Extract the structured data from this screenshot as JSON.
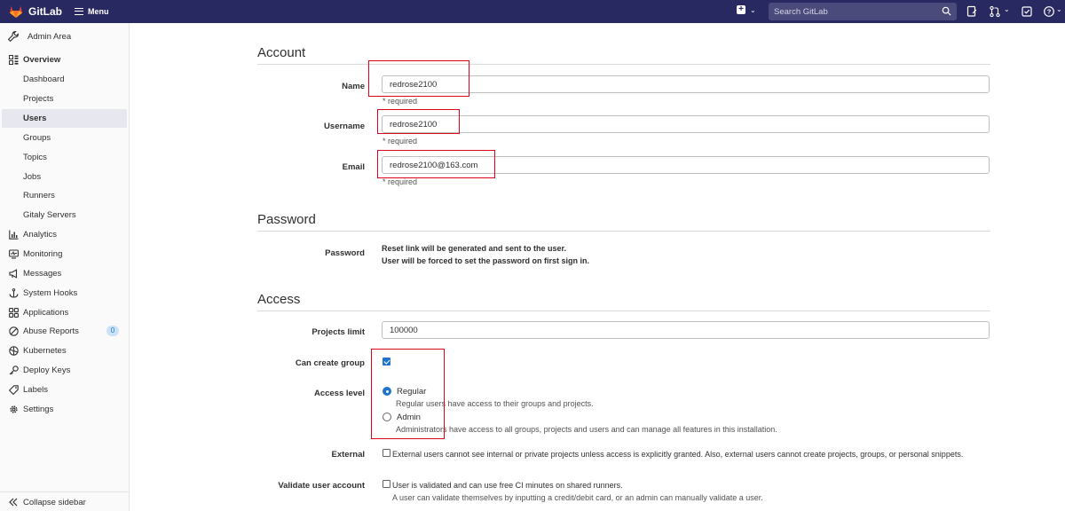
{
  "topbar": {
    "brand": "GitLab",
    "menu_label": "Menu",
    "search_placeholder": "Search GitLab"
  },
  "sidebar": {
    "header": "Admin Area",
    "items": [
      {
        "label": "Overview"
      },
      {
        "label": "Dashboard"
      },
      {
        "label": "Projects"
      },
      {
        "label": "Users"
      },
      {
        "label": "Groups"
      },
      {
        "label": "Topics"
      },
      {
        "label": "Jobs"
      },
      {
        "label": "Runners"
      },
      {
        "label": "Gitaly Servers"
      },
      {
        "label": "Analytics"
      },
      {
        "label": "Monitoring"
      },
      {
        "label": "Messages"
      },
      {
        "label": "System Hooks"
      },
      {
        "label": "Applications"
      },
      {
        "label": "Abuse Reports",
        "count": "0"
      },
      {
        "label": "Kubernetes"
      },
      {
        "label": "Deploy Keys"
      },
      {
        "label": "Labels"
      },
      {
        "label": "Settings"
      }
    ],
    "collapse_label": "Collapse sidebar"
  },
  "account": {
    "title": "Account",
    "name_label": "Name",
    "name_value": "redrose2100",
    "username_label": "Username",
    "username_value": "redrose2100",
    "email_label": "Email",
    "email_value": "redrose2100@163.com",
    "required": "* required"
  },
  "password": {
    "title": "Password",
    "label": "Password",
    "line1": "Reset link will be generated and sent to the user.",
    "line2": "User will be forced to set the password on first sign in."
  },
  "access": {
    "title": "Access",
    "projects_limit_label": "Projects limit",
    "projects_limit_value": "100000",
    "can_create_group_label": "Can create group",
    "can_create_group_checked": true,
    "access_level_label": "Access level",
    "regular_label": "Regular",
    "regular_help": "Regular users have access to their groups and projects.",
    "admin_label": "Admin",
    "admin_help": "Administrators have access to all groups, projects and users and can manage all features in this installation.",
    "selected_level": "Regular",
    "external_label": "External",
    "external_text": "External users cannot see internal or private projects unless access is explicitly granted. Also, external users cannot create projects, groups, or personal snippets.",
    "validate_label": "Validate user account",
    "validate_text": "User is validated and can use free CI minutes on shared runners.",
    "validate_help": "A user can validate themselves by inputting a credit/debit card, or an admin can manually validate a user."
  },
  "colors": {
    "topbar": "#292961",
    "accent": "#1f75cb",
    "annotation": "#e0001b"
  }
}
